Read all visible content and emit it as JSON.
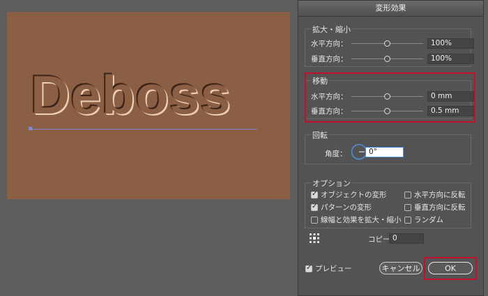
{
  "artwork": {
    "text": "Deboss"
  },
  "dialog": {
    "title": "変形効果",
    "scale": {
      "title": "拡大・縮小",
      "horizontal_label": "水平方向：",
      "horizontal_value": "100%",
      "vertical_label": "垂直方向：",
      "vertical_value": "100%"
    },
    "move": {
      "title": "移動",
      "horizontal_label": "水平方向：",
      "horizontal_value": "0 mm",
      "vertical_label": "垂直方向：",
      "vertical_value": "0.5 mm"
    },
    "rotate": {
      "title": "回転",
      "angle_label": "角度：",
      "angle_value": "0°"
    },
    "options": {
      "title": "オプション",
      "transform_objects": "オブジェクトの変形",
      "transform_patterns": "パターンの変形",
      "scale_strokes": "線幅と効果を拡大・縮小",
      "reflect_x": "水平方向に反転",
      "reflect_y": "垂直方向に反転",
      "random": "ランダム",
      "transform_objects_checked": true,
      "transform_patterns_checked": true,
      "scale_strokes_checked": false,
      "reflect_x_checked": false,
      "reflect_y_checked": false,
      "random_checked": false
    },
    "copies": {
      "label": "コピー",
      "value": "0"
    },
    "preview": {
      "label": "プレビュー",
      "checked": true
    },
    "cancel_label": "キャンセル",
    "ok_label": "OK"
  },
  "colors": {
    "highlight": "#c0102a",
    "artboard": "#8b5f44"
  }
}
